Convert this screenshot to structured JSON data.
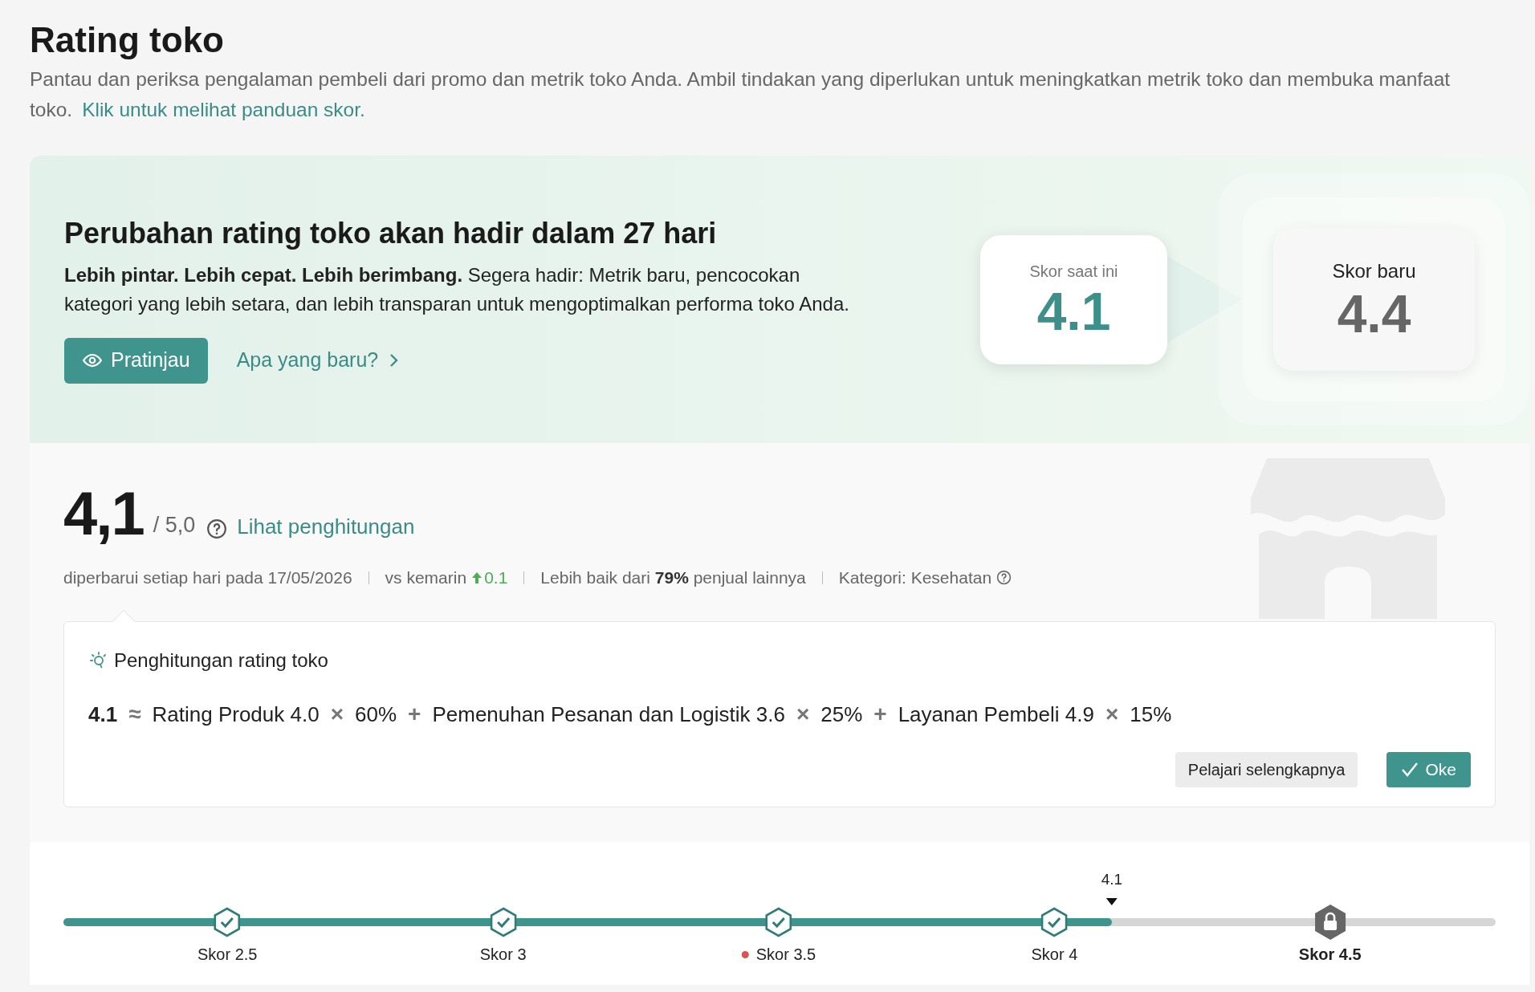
{
  "page": {
    "title": "Rating toko",
    "description": "Pantau dan periksa pengalaman pembeli dari promo dan metrik toko Anda. Ambil tindakan yang diperlukan untuk meningkatkan metrik toko dan membuka manfaat toko.",
    "guide_link": "Klik untuk melihat panduan skor."
  },
  "banner": {
    "title": "Perubahan rating toko akan hadir dalam 27 hari",
    "text": "**Lebih pintar. Lebih cepat. Lebih berimbang.** Segera hadir: Metrik baru, pencocokan kategori yang lebih setara, dan lebih transparan untuk mengoptimalkan performa toko Anda.",
    "preview_button": "Pratinjau",
    "whats_new_link": "Apa yang baru?",
    "current_score": {
      "label": "Skor saat ini",
      "value": "4.1"
    },
    "new_score": {
      "label": "Skor baru",
      "value": "4.4"
    }
  },
  "score": {
    "value": "4,1",
    "max": "/ 5,0",
    "calc_link": "Lihat penghitungan",
    "meta": [
      {
        "kind": "text",
        "text": "diperbarui setiap hari pada 17/05/2026"
      },
      {
        "kind": "change",
        "text": "vs kemarin",
        "delta": "0.1"
      },
      {
        "kind": "text",
        "text": "Lebih baik dari **79%** penjual lainnya"
      },
      {
        "kind": "help",
        "text": "Kategori: Kesehatan"
      }
    ]
  },
  "calculation": {
    "title": "Penghitungan rating toko",
    "formula": [
      {
        "kind": "result",
        "text": "4.1"
      },
      {
        "kind": "op",
        "text": "≈"
      },
      {
        "kind": "term",
        "text": "Rating Produk 4.0"
      },
      {
        "kind": "op",
        "text": "×"
      },
      {
        "kind": "term",
        "text": "60%"
      },
      {
        "kind": "op",
        "text": "+"
      },
      {
        "kind": "term",
        "text": "Pemenuhan Pesanan dan Logistik 3.6"
      },
      {
        "kind": "op",
        "text": "×"
      },
      {
        "kind": "term",
        "text": "25%"
      },
      {
        "kind": "op",
        "text": "+"
      },
      {
        "kind": "term",
        "text": "Layanan Pembeli 4.9"
      },
      {
        "kind": "op",
        "text": "×"
      },
      {
        "kind": "term",
        "text": "15%"
      }
    ],
    "learn_more_button": "Pelajari selengkapnya",
    "ok_button": "Oke"
  },
  "progress": {
    "level": 0.732,
    "marker": "4.1",
    "milestones": [
      {
        "label": "Skor 2.5",
        "locked": false,
        "flagged": false
      },
      {
        "label": "Skor 3",
        "locked": false,
        "flagged": false
      },
      {
        "label": "Skor 3.5",
        "locked": false,
        "flagged": true
      },
      {
        "label": "Skor 4",
        "locked": false,
        "flagged": false
      },
      {
        "label": "Skor 4.5",
        "locked": true,
        "flagged": false
      }
    ]
  }
}
